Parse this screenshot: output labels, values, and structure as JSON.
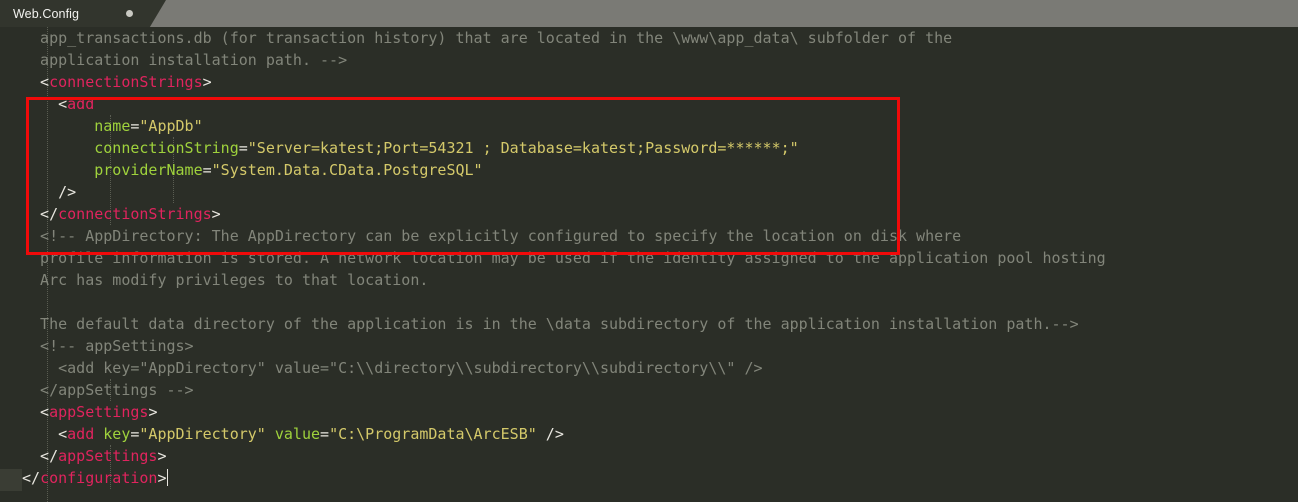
{
  "tab": {
    "label": "Web.Config",
    "modified_indicator": "dot"
  },
  "editor": {
    "language": "xml",
    "caret_after": "</configuration>",
    "colors": {
      "background": "#2b2e27",
      "tab_bar": "#7a7a75",
      "tab_active": "#32352d",
      "punctuation": "#e8e6df",
      "tag_name": "#e0245e",
      "attribute_name": "#9fd23c",
      "attribute_value": "#d4c96a",
      "comment": "#82857a",
      "annotation_box": "#f10a0a"
    },
    "annotation": {
      "type": "red-rectangle",
      "encloses": "connectionStrings element"
    },
    "lines": [
      {
        "id": "l1",
        "tokens": [
          {
            "t": "comment",
            "v": "  app_transactions.db (for transaction history) that are located in the \\www\\app_data\\ subfolder of the"
          }
        ]
      },
      {
        "id": "l2",
        "tokens": [
          {
            "t": "comment",
            "v": "  application installation path. -->"
          }
        ]
      },
      {
        "id": "l3",
        "tokens": [
          {
            "t": "punct",
            "v": "  <"
          },
          {
            "t": "tagname",
            "v": "connectionStrings"
          },
          {
            "t": "punct",
            "v": ">"
          }
        ]
      },
      {
        "id": "l4",
        "tokens": [
          {
            "t": "punct",
            "v": "    <"
          },
          {
            "t": "tagname",
            "v": "add"
          }
        ]
      },
      {
        "id": "l5",
        "tokens": [
          {
            "t": "attr",
            "v": "        name"
          },
          {
            "t": "eq",
            "v": "="
          },
          {
            "t": "val",
            "v": "\"AppDb\""
          }
        ]
      },
      {
        "id": "l6",
        "tokens": [
          {
            "t": "attr",
            "v": "        connectionString"
          },
          {
            "t": "eq",
            "v": "="
          },
          {
            "t": "val",
            "v": "\"Server=katest;Port=54321 ; Database=katest;Password=******;\""
          }
        ]
      },
      {
        "id": "l7",
        "tokens": [
          {
            "t": "attr",
            "v": "        providerName"
          },
          {
            "t": "eq",
            "v": "="
          },
          {
            "t": "val",
            "v": "\"System.Data.CData.PostgreSQL\""
          }
        ]
      },
      {
        "id": "l8",
        "tokens": [
          {
            "t": "punct",
            "v": "    />"
          }
        ]
      },
      {
        "id": "l9",
        "tokens": [
          {
            "t": "punct",
            "v": "  </"
          },
          {
            "t": "tagname",
            "v": "connectionStrings"
          },
          {
            "t": "punct",
            "v": ">"
          }
        ]
      },
      {
        "id": "l10",
        "tokens": [
          {
            "t": "comment",
            "v": "  <!-- AppDirectory: The AppDirectory can be explicitly configured to specify the location on disk where"
          }
        ]
      },
      {
        "id": "l11",
        "tokens": [
          {
            "t": "comment",
            "v": "  profile information is stored. A network location may be used if the identity assigned to the application pool hosting"
          }
        ]
      },
      {
        "id": "l12",
        "tokens": [
          {
            "t": "comment",
            "v": "  Arc has modify privileges to that location."
          }
        ]
      },
      {
        "id": "l13",
        "tokens": [
          {
            "t": "comment",
            "v": ""
          }
        ]
      },
      {
        "id": "l14",
        "tokens": [
          {
            "t": "comment",
            "v": "  The default data directory of the application is in the \\data subdirectory of the application installation path.-->"
          }
        ]
      },
      {
        "id": "l15",
        "tokens": [
          {
            "t": "comment",
            "v": "  <!-- appSettings>"
          }
        ]
      },
      {
        "id": "l16",
        "tokens": [
          {
            "t": "comment",
            "v": "    <add key=\"AppDirectory\" value=\"C:\\\\directory\\\\subdirectory\\\\subdirectory\\\\\" />"
          }
        ]
      },
      {
        "id": "l17",
        "tokens": [
          {
            "t": "comment",
            "v": "  </appSettings -->"
          }
        ]
      },
      {
        "id": "l18",
        "tokens": [
          {
            "t": "punct",
            "v": "  <"
          },
          {
            "t": "tagname",
            "v": "appSettings"
          },
          {
            "t": "punct",
            "v": ">"
          }
        ]
      },
      {
        "id": "l19",
        "tokens": [
          {
            "t": "punct",
            "v": "    <"
          },
          {
            "t": "tagname",
            "v": "add"
          },
          {
            "t": "attr",
            "v": " key"
          },
          {
            "t": "eq",
            "v": "="
          },
          {
            "t": "val",
            "v": "\"AppDirectory\""
          },
          {
            "t": "attr",
            "v": " value"
          },
          {
            "t": "eq",
            "v": "="
          },
          {
            "t": "val",
            "v": "\"C:\\ProgramData\\ArcESB\""
          },
          {
            "t": "punct",
            "v": " />"
          }
        ]
      },
      {
        "id": "l20",
        "tokens": [
          {
            "t": "punct",
            "v": "  </"
          },
          {
            "t": "tagname",
            "v": "appSettings"
          },
          {
            "t": "punct",
            "v": ">"
          }
        ]
      },
      {
        "id": "l21",
        "caret": true,
        "tokens": [
          {
            "t": "punct",
            "v": "</"
          },
          {
            "t": "tagname",
            "v": "configuration"
          },
          {
            "t": "punct",
            "v": ">"
          }
        ]
      }
    ]
  }
}
